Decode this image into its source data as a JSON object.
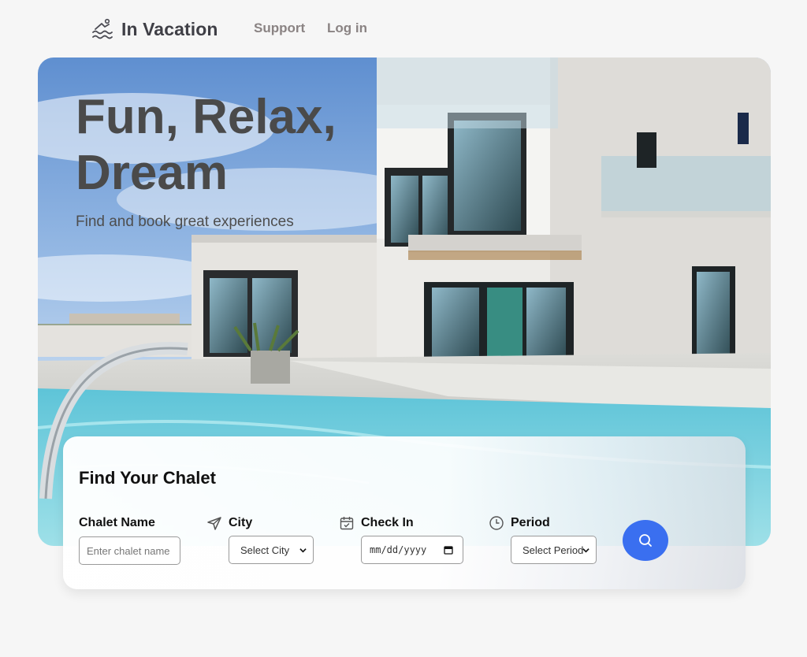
{
  "nav": {
    "brand": "In Vacation",
    "links": [
      {
        "label": "Support"
      },
      {
        "label": "Log in"
      }
    ]
  },
  "hero": {
    "title": "Fun, Relax, Dream",
    "subtitle": "Find and book great experiences"
  },
  "search": {
    "title": "Find Your Chalet",
    "chalet_name": {
      "label": "Chalet Name",
      "placeholder": "Enter chalet name"
    },
    "city": {
      "label": "City",
      "selected": "Select City"
    },
    "check_in": {
      "label": "Check In",
      "value": "mm/dd/yyyy"
    },
    "period": {
      "label": "Period",
      "selected": "Select Period"
    },
    "button_icon": "search-icon"
  },
  "colors": {
    "accent": "#3a6ff0",
    "brand_text": "#3f3f46",
    "nav_link": "#8a8383"
  }
}
